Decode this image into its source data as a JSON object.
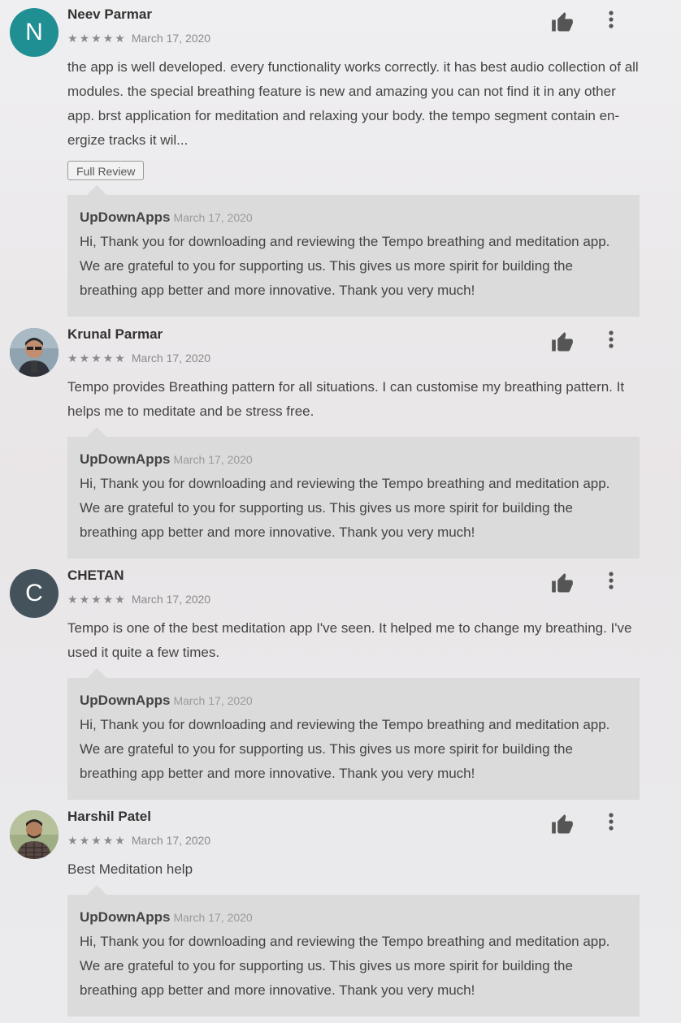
{
  "reviews": [
    {
      "name": "Neev Parmar",
      "avatar_letter": "N",
      "avatar_color": "#1f8f94",
      "rating": 5,
      "stars": [
        "★",
        "★",
        "★",
        "★",
        "★"
      ],
      "date": "March 17, 2020",
      "text": "the app is well developed. every functionality works correctly. it has best audio collection of all modules. the special breathing feature is new and amazing you can not find it in any other app. brst application for meditation and relaxing your body. the tempo segment contain en-ergize tracks it wil...",
      "full_review_label": "Full Review",
      "reply": {
        "developer": "UpDownApps",
        "date": "March 17, 2020",
        "text": "Hi, Thank you for downloading and reviewing the Tempo breathing and meditation app. We are grateful to you for supporting us. This gives us more spirit for building the breathing app better and more innovative. Thank you very much!"
      }
    },
    {
      "name": "Krunal Parmar",
      "avatar_letter": "",
      "avatar_color": "#6f7e8a",
      "rating": 5,
      "stars": [
        "★",
        "★",
        "★",
        "★",
        "★"
      ],
      "date": "March 17, 2020",
      "text": "Tempo provides Breathing pattern for all situations. I can customise my breathing pattern. It helps me to meditate and be stress free.",
      "reply": {
        "developer": "UpDownApps",
        "date": "March 17, 2020",
        "text": "Hi, Thank you for downloading and reviewing the Tempo breathing and meditation app. We are grateful to you for supporting us. This gives us more spirit for building the breathing app better and more innovative. Thank you very much!"
      }
    },
    {
      "name": "CHETAN",
      "avatar_letter": "C",
      "avatar_color": "#44525c",
      "rating": 5,
      "stars": [
        "★",
        "★",
        "★",
        "★",
        "★"
      ],
      "date": "March 17, 2020",
      "text": "Tempo is one of the best meditation app I've seen. It helped me to change my breathing. I've used it quite a few times.",
      "reply": {
        "developer": "UpDownApps",
        "date": "March 17, 2020",
        "text": "Hi, Thank you for downloading and reviewing the Tempo breathing and meditation app. We are grateful to you for supporting us. This gives us more spirit for building the breathing app better and more innovative. Thank you very much!"
      }
    },
    {
      "name": "Harshil Patel",
      "avatar_letter": "",
      "avatar_color": "#8a9a6e",
      "rating": 5,
      "stars": [
        "★",
        "★",
        "★",
        "★",
        "★"
      ],
      "date": "March 17, 2020",
      "text": "Best Meditation help",
      "reply": {
        "developer": "UpDownApps",
        "date": "March 17, 2020",
        "text": "Hi, Thank you for downloading and reviewing the Tempo breathing and meditation app. We are grateful to you for supporting us. This gives us more spirit for building the breathing app better and more innovative. Thank you very much!"
      }
    }
  ],
  "icons": {
    "like": "thumbs-up-icon",
    "more": "more-vert-icon",
    "star": "star-icon"
  }
}
